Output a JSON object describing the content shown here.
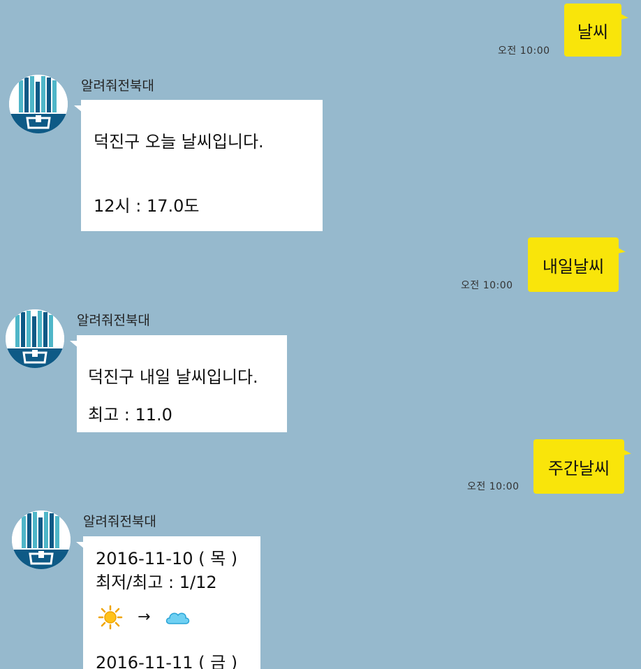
{
  "messages": {
    "m1": {
      "text": "날씨",
      "time": "오전 10:00"
    },
    "r1": {
      "sender": "알려줘전북대",
      "line1": "덕진구 오늘 날씨입니다.",
      "line2": "12시 : 17.0도"
    },
    "m2": {
      "text": "내일날씨",
      "time": "오전 10:00"
    },
    "r2": {
      "sender": "알려줘전북대",
      "line1": "덕진구 내일 날씨입니다.",
      "line2": "최고 : 11.0"
    },
    "m3": {
      "text": "주간날씨",
      "time": "오전 10:00"
    },
    "r3": {
      "sender": "알려줘전북대",
      "day1_date": "2016-11-10 ( 목 )",
      "day1_temp": "최저/최고 : 1/12",
      "day1_icon_from": "sun-icon",
      "day1_arrow": "→",
      "day1_icon_to": "cloud-icon",
      "day2_date": "2016-11-11 ( 금 )"
    }
  },
  "colors": {
    "background": "#96b9cd",
    "outgoing_bubble": "#f9e50a",
    "incoming_bubble": "#ffffff",
    "avatar_dark": "#0e5a86",
    "avatar_light": "#4fb6c8"
  }
}
